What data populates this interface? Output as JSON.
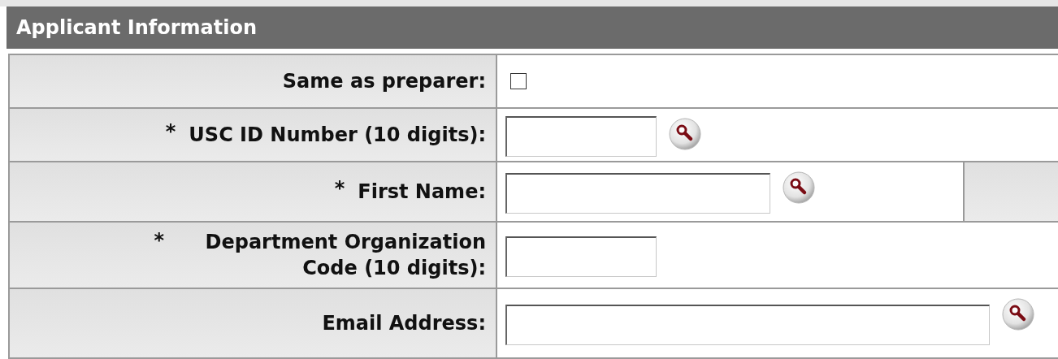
{
  "section": {
    "title": "Applicant Information"
  },
  "rows": [
    {
      "kind": "checkbox",
      "label": "Same as preparer:",
      "checked": false,
      "trailing_cell": false
    },
    {
      "kind": "text",
      "required_mark": "*",
      "label": "USC ID Number (10 digits):",
      "lookup": true,
      "trailing_cell": false
    },
    {
      "kind": "text",
      "required_mark": "*",
      "label": "First Name:",
      "lookup": true,
      "trailing_cell": true
    },
    {
      "kind": "text",
      "required_mark": "*",
      "label": "Department Organization Code (10 digits):",
      "lookup": false,
      "trailing_cell": false
    },
    {
      "kind": "text",
      "label": "Email Address:",
      "lookup": true,
      "trailing_cell": false
    }
  ]
}
